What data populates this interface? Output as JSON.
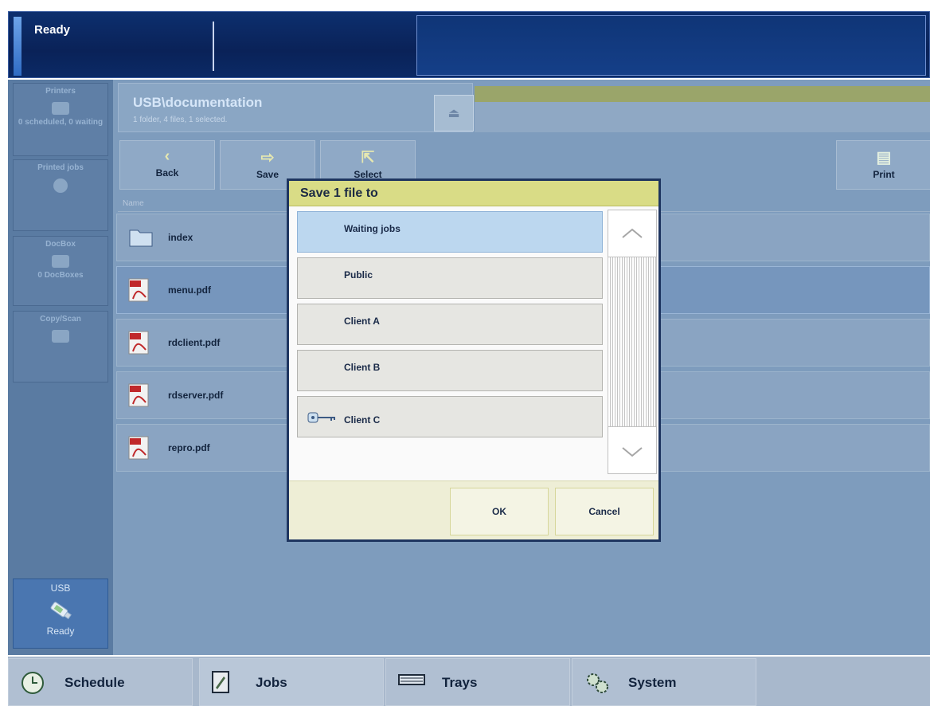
{
  "status": {
    "text": "Ready"
  },
  "sidebar": {
    "items": [
      {
        "label": "Printers",
        "sub": "0 scheduled, 0 waiting"
      },
      {
        "label": "Printed jobs"
      },
      {
        "label": "DocBox",
        "sub": "0 DocBoxes"
      },
      {
        "label": "Copy/Scan"
      }
    ],
    "usb": {
      "label": "USB",
      "status": "Ready"
    }
  },
  "location": {
    "title": "USB\\documentation",
    "subtitle": "1 folder, 4 files, 1 selected."
  },
  "toolbar": {
    "back_label": "Back",
    "save_label": "Save",
    "select_label": "Select",
    "print_label": "Print"
  },
  "files": {
    "column_name": "Name",
    "rows": [
      {
        "name": "index",
        "type": "folder",
        "selected": false
      },
      {
        "name": "menu.pdf",
        "type": "pdf",
        "selected": true
      },
      {
        "name": "rdclient.pdf",
        "type": "pdf",
        "selected": false
      },
      {
        "name": "rdserver.pdf",
        "type": "pdf",
        "selected": false
      },
      {
        "name": "repro.pdf",
        "type": "pdf",
        "selected": false
      }
    ]
  },
  "dialog": {
    "title": "Save 1 file to",
    "items": [
      {
        "label": "Waiting jobs",
        "selected": true
      },
      {
        "label": "Public",
        "selected": false
      },
      {
        "label": "Client A",
        "selected": false
      },
      {
        "label": "Client B",
        "selected": false
      },
      {
        "label": "Client C",
        "selected": false,
        "locked": true
      }
    ],
    "ok_label": "OK",
    "cancel_label": "Cancel"
  },
  "nav": {
    "tabs": [
      {
        "label": "Schedule",
        "icon": "clock-icon"
      },
      {
        "label": "Jobs",
        "icon": "document-icon",
        "active": true
      },
      {
        "label": "Trays",
        "icon": "tray-icon"
      },
      {
        "label": "System",
        "icon": "gears-icon"
      }
    ]
  },
  "colors": {
    "topbar": "#0a2258",
    "dialog_title": "#d9dc86",
    "selected_item": "#bcd7ef"
  }
}
